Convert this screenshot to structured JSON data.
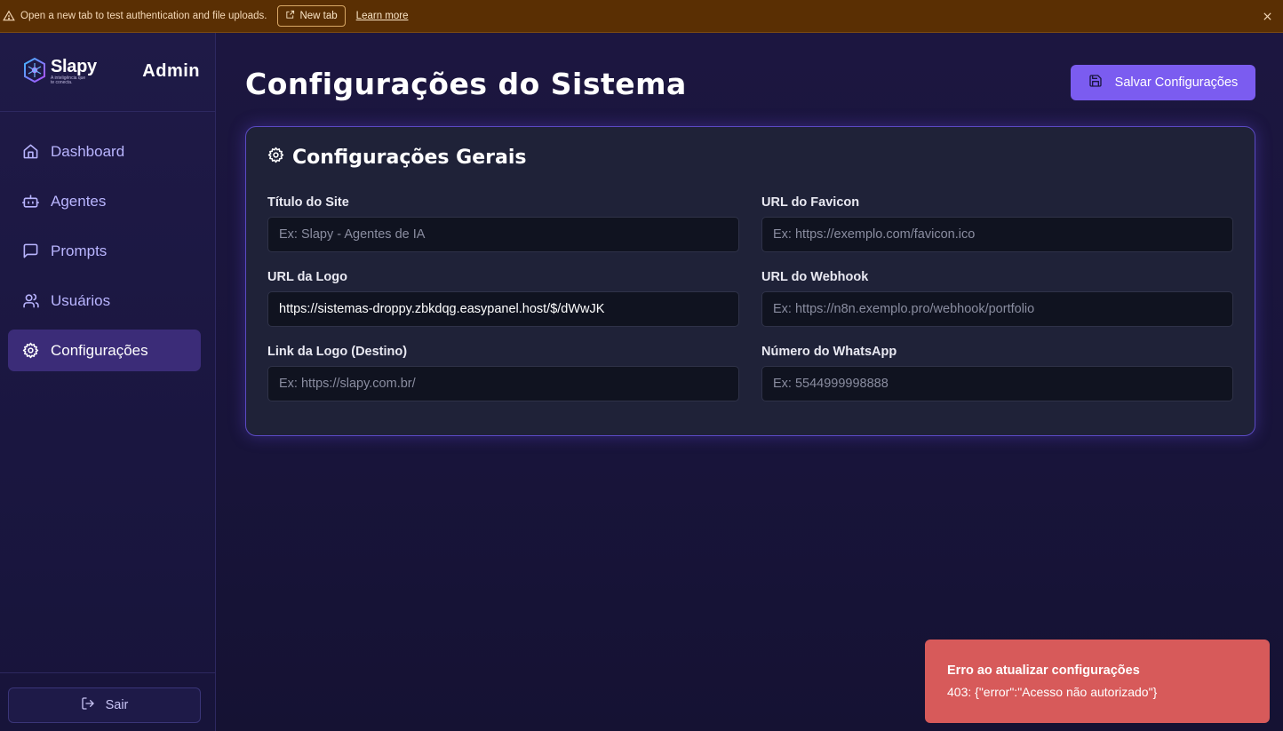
{
  "banner": {
    "message": "Open a new tab to test authentication and file uploads.",
    "new_tab_label": "New tab",
    "learn_more_label": "Learn more"
  },
  "sidebar": {
    "brand": "Slapy",
    "tagline": "A inteligência que te conecta.",
    "admin_label": "Admin",
    "items": [
      {
        "label": "Dashboard",
        "icon": "home-icon"
      },
      {
        "label": "Agentes",
        "icon": "bot-icon"
      },
      {
        "label": "Prompts",
        "icon": "message-square-icon"
      },
      {
        "label": "Usuários",
        "icon": "users-icon"
      },
      {
        "label": "Configurações",
        "icon": "gear-icon",
        "active": true
      }
    ],
    "logout_label": "Sair"
  },
  "header": {
    "title": "Configurações do Sistema",
    "save_label": "Salvar Configurações"
  },
  "card": {
    "title": "Configurações Gerais",
    "fields": [
      {
        "label": "Título do Site",
        "value": "",
        "placeholder": "Ex: Slapy - Agentes de IA"
      },
      {
        "label": "URL do Favicon",
        "value": "",
        "placeholder": "Ex: https://exemplo.com/favicon.ico"
      },
      {
        "label": "URL da Logo",
        "value": "https://sistemas-droppy.zbkdqg.easypanel.host/$/dWwJK",
        "placeholder": ""
      },
      {
        "label": "URL do Webhook",
        "value": "",
        "placeholder": "Ex: https://n8n.exemplo.pro/webhook/portfolio"
      },
      {
        "label": "Link da Logo (Destino)",
        "value": "",
        "placeholder": "Ex: https://slapy.com.br/"
      },
      {
        "label": "Número do WhatsApp",
        "value": "",
        "placeholder": "Ex: 5544999998888"
      }
    ]
  },
  "toast": {
    "title": "Erro ao atualizar configurações",
    "message": "403: {\"error\":\"Acesso não autorizado\"}"
  },
  "colors": {
    "accent": "#7b5cf0",
    "banner_bg": "#5a2f03",
    "toast_bg": "#d75a5a",
    "active_nav": "#3b2c78"
  }
}
